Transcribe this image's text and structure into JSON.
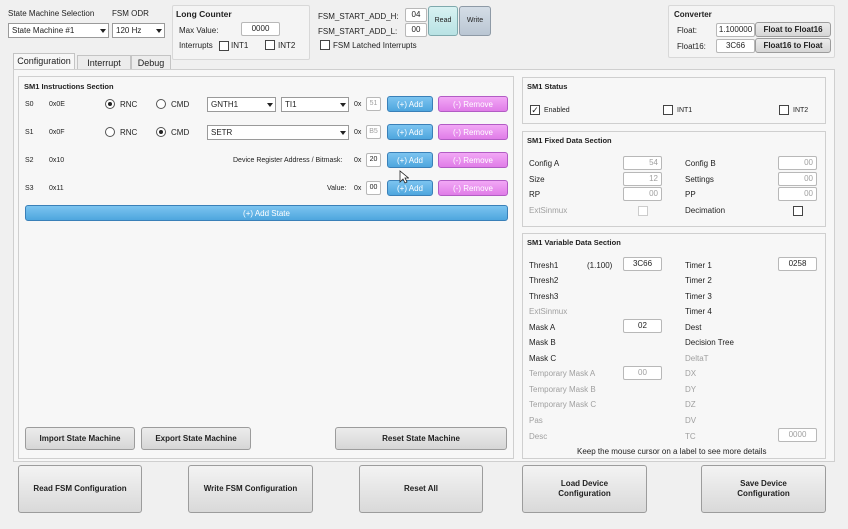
{
  "top": {
    "sm_selection_label": "State Machine Selection",
    "sm_selection_value": "State Machine #1",
    "odr_label": "FSM ODR",
    "odr_value": "120 Hz",
    "long_counter": {
      "title": "Long Counter",
      "max_value_label": "Max Value:",
      "max_value": "0000",
      "interrupts_label": "Interrupts",
      "int1_label": "INT1",
      "int2_label": "INT2"
    },
    "fsm_start": {
      "h_label": "FSM_START_ADD_H:",
      "h_value": "04",
      "l_label": "FSM_START_ADD_L:",
      "l_value": "00",
      "read_label": "Read",
      "write_label": "Write",
      "latched_label": "FSM Latched Interrupts"
    },
    "converter": {
      "title": "Converter",
      "float_label": "Float:",
      "float_value": "1.100000",
      "float16_label": "Float16:",
      "float16_value": "3C66",
      "to_f16_label": "Float to Float16",
      "to_float_label": "Float16 to Float"
    }
  },
  "tabs": [
    "Configuration",
    "Interrupt",
    "Debug"
  ],
  "instructions": {
    "title": "SM1 Instructions Section",
    "rnc_label": "RNC",
    "cmd_label": "CMD",
    "hex_prefix": "0x",
    "add_label": "(+) Add",
    "remove_label": "(-) Remove",
    "device_register_label": "Device Register Address / Bitmask:",
    "value_label": "Value:",
    "rows": [
      {
        "state": "S0",
        "addr": "0x0E",
        "combo1": "GNTH1",
        "combo2": "TI1",
        "hex": "51"
      },
      {
        "state": "S1",
        "addr": "0x0F",
        "combo_wide": "SETR",
        "hex": "B5"
      },
      {
        "state": "S2",
        "addr": "0x10",
        "hex": "20"
      },
      {
        "state": "S3",
        "addr": "0x11",
        "hex": "00"
      }
    ],
    "add_state_label": "(+) Add State",
    "import_label": "Import State Machine",
    "export_label": "Export State Machine",
    "reset_sm_label": "Reset State Machine"
  },
  "status": {
    "title": "SM1 Status",
    "enabled_label": "Enabled",
    "int1_label": "INT1",
    "int2_label": "INT2"
  },
  "fixed": {
    "title": "SM1 Fixed Data Section",
    "config_a_label": "Config A",
    "config_a": "54",
    "size_label": "Size",
    "size": "12",
    "rp_label": "RP",
    "rp": "00",
    "extsinmux_label": "ExtSinmux",
    "config_b_label": "Config B",
    "config_b": "00",
    "settings_label": "Settings",
    "settings": "00",
    "pp_label": "PP",
    "pp": "00",
    "decimation_label": "Decimation"
  },
  "variable": {
    "title": "SM1 Variable Data Section",
    "thresh1_label": "Thresh1",
    "thresh1_float": "(1.100)",
    "thresh1": "3C66",
    "thresh2_label": "Thresh2",
    "thresh3_label": "Thresh3",
    "extsinmux_label": "ExtSinmux",
    "mask_a_label": "Mask A",
    "mask_a": "02",
    "mask_b_label": "Mask B",
    "mask_c_label": "Mask C",
    "tmask_a_label": "Temporary Mask A",
    "tmask_a": "00",
    "tmask_b_label": "Temporary Mask B",
    "tmask_c_label": "Temporary Mask C",
    "pas_label": "Pas",
    "desc_label": "Desc",
    "timer1_label": "Timer 1",
    "timer1": "0258",
    "timer2_label": "Timer 2",
    "timer3_label": "Timer 3",
    "timer4_label": "Timer 4",
    "dest_label": "Dest",
    "decision_tree_label": "Decision Tree",
    "deltat_label": "DeltaT",
    "dx_label": "DX",
    "dy_label": "DY",
    "dz_label": "DZ",
    "dv_label": "DV",
    "tc_label": "TC",
    "tc": "0000",
    "hint": "Keep the mouse cursor on a label to see more details"
  },
  "bottom": {
    "read_fsm": "Read FSM Configuration",
    "write_fsm": "Write FSM Configuration",
    "reset_all": "Reset All",
    "load_device": "Load Device Configuration",
    "save_device": "Save Device Configuration"
  }
}
